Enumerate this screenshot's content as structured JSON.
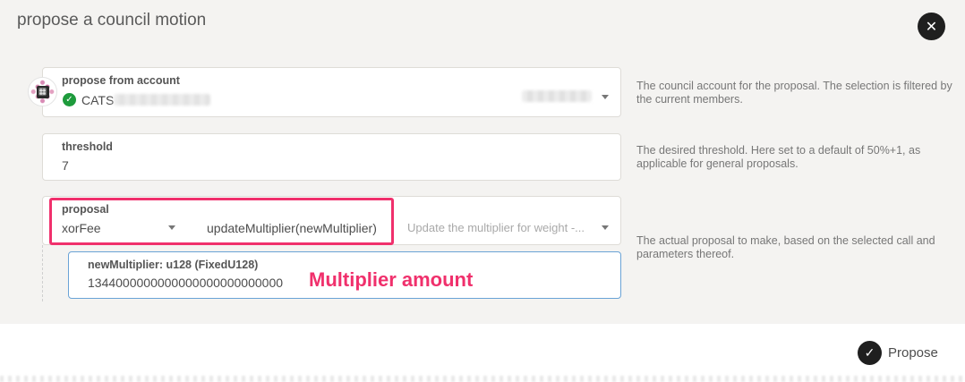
{
  "modal": {
    "title": "propose a council motion",
    "close_icon": "close-icon"
  },
  "account": {
    "label": "propose from account",
    "name": "CATS",
    "status_icon": "check-icon",
    "help": "The council account for the proposal. The selection is filtered by the current members."
  },
  "threshold": {
    "label": "threshold",
    "value": "7",
    "help": "The desired threshold. Here set to a default of 50%+1, as applicable for general proposals."
  },
  "proposal": {
    "label": "proposal",
    "section": "xorFee",
    "method": "updateMultiplier(newMultiplier)",
    "description": "Update the multiplier for weight -...",
    "help": "The actual proposal to make, based on the selected call and parameters thereof."
  },
  "param": {
    "label": "newMultiplier: u128 (FixedU128)",
    "value": "1344000000000000000000000000"
  },
  "annotation": {
    "text": "Multiplier amount",
    "color": "#f0306c"
  },
  "footer": {
    "propose_label": "Propose",
    "propose_icon": "checkmark-icon"
  }
}
